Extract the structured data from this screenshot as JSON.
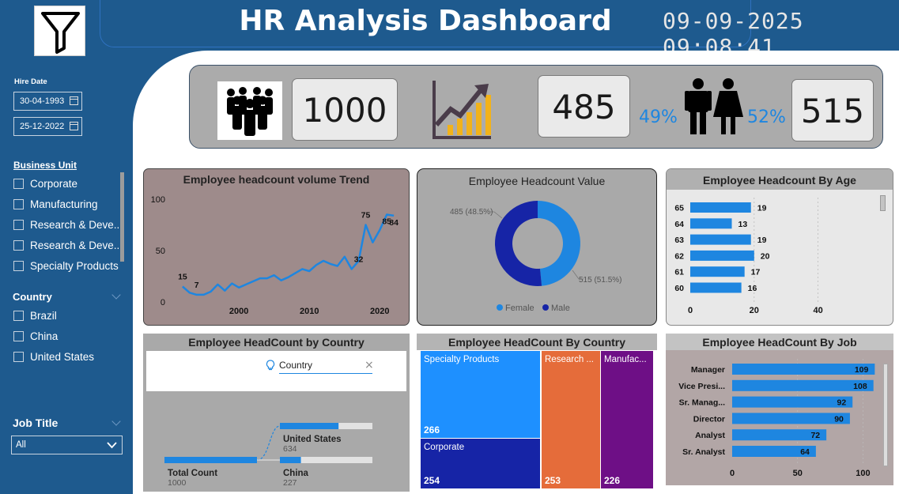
{
  "header": {
    "title": "HR Analysis Dashboard",
    "datetime": "09-09-2025 09:08:41",
    "logo_icon": "filter-icon"
  },
  "sidebar": {
    "hire_date": {
      "label": "Hire Date",
      "from": "30-04-1993",
      "to": "25-12-2022"
    },
    "business_unit": {
      "label": "Business Unit",
      "items": [
        "Corporate",
        "Manufacturing",
        "Research & Deve...",
        "Research & Deve...",
        "Specialty Products"
      ]
    },
    "country": {
      "label": "Country",
      "items": [
        "Brazil",
        "China",
        "United States"
      ]
    },
    "job_title": {
      "label": "Job Title",
      "selected": "All"
    }
  },
  "kpis": {
    "total": "1000",
    "female": "485",
    "female_pct": "49%",
    "male_pct": "52%",
    "male": "515",
    "icons": [
      "people-group-icon",
      "growth-chart-icon",
      "man-woman-icon"
    ],
    "colors": {
      "bar_bg": "#ababab",
      "pct": "#1e86e0"
    }
  },
  "chart_data": [
    {
      "type": "line",
      "title": "Employee headcount volume Trend",
      "x": [
        1992,
        1993,
        1994,
        1995,
        1996,
        1997,
        1998,
        1999,
        2000,
        2001,
        2002,
        2003,
        2004,
        2005,
        2006,
        2007,
        2008,
        2009,
        2010,
        2011,
        2012,
        2013,
        2014,
        2015,
        2016,
        2017,
        2018,
        2019,
        2020,
        2021,
        2022
      ],
      "values": [
        15,
        9,
        7,
        7,
        10,
        17,
        11,
        18,
        14,
        17,
        20,
        23,
        23,
        26,
        21,
        24,
        28,
        32,
        30,
        36,
        40,
        37,
        35,
        44,
        32,
        40,
        75,
        58,
        70,
        85,
        84
      ],
      "point_labels": [
        {
          "x": 1992,
          "y": 15,
          "text": "15"
        },
        {
          "x": 1994,
          "y": 7,
          "text": "7"
        },
        {
          "x": 2017,
          "y": 32,
          "text": "32"
        },
        {
          "x": 2018,
          "y": 75,
          "text": "75"
        },
        {
          "x": 2021,
          "y": 85,
          "text": "85"
        },
        {
          "x": 2022,
          "y": 84,
          "text": "84"
        }
      ],
      "yticks": [
        "0",
        "50",
        "100"
      ],
      "xticks": [
        2000,
        2010,
        2020
      ],
      "ylim": [
        0,
        100
      ],
      "xlim": [
        1991,
        2023
      ],
      "color": "#1e86e0",
      "bg": "#9e8b8b"
    },
    {
      "type": "pie",
      "title": "Employee Headcount Value",
      "slices": [
        {
          "name": "Female",
          "value": 485,
          "label": "485 (48.5%)",
          "color": "#1e86e0"
        },
        {
          "name": "Male",
          "value": 515,
          "label": "515 (51.5%)",
          "color": "#1624a6"
        }
      ],
      "legend": [
        "Female",
        "Male"
      ]
    },
    {
      "type": "bar",
      "title": "Employee Headcount By Age",
      "categories": [
        "65",
        "64",
        "63",
        "62",
        "61",
        "60"
      ],
      "values": [
        19,
        13,
        19,
        20,
        17,
        16
      ],
      "xticks": [
        "0",
        "20",
        "40"
      ],
      "xlim": [
        0,
        50
      ],
      "color": "#1e86e0"
    },
    {
      "type": "bar",
      "title": "Employee HeadCount by Country",
      "search_placeholder": "Country",
      "root": {
        "label": "Total Count",
        "value": "1000"
      },
      "nodes": [
        {
          "label": "United States",
          "value": "634"
        },
        {
          "label": "China",
          "value": "227"
        }
      ],
      "max": 1000,
      "color": "#1e86e0"
    },
    {
      "type": "heatmap",
      "title": "Employee HeadCount By Country",
      "cells": [
        {
          "label": "Specialty Products",
          "value": "266",
          "color": "#1e90ff"
        },
        {
          "label": "Corporate",
          "value": "254",
          "color": "#1624a6"
        },
        {
          "label": "Research ...",
          "value": "253",
          "color": "#e56c3a"
        },
        {
          "label": "Manufac...",
          "value": "226",
          "color": "#6e0f86"
        }
      ]
    },
    {
      "type": "bar",
      "title": "Employee HeadCount By Job",
      "categories": [
        "Manager",
        "Vice Presi...",
        "Sr. Manag...",
        "Director",
        "Analyst",
        "Sr. Analyst"
      ],
      "values": [
        109,
        108,
        92,
        90,
        72,
        64
      ],
      "xticks": [
        "0",
        "50",
        "100"
      ],
      "xlim": [
        0,
        110
      ],
      "color": "#1e86e0"
    }
  ]
}
